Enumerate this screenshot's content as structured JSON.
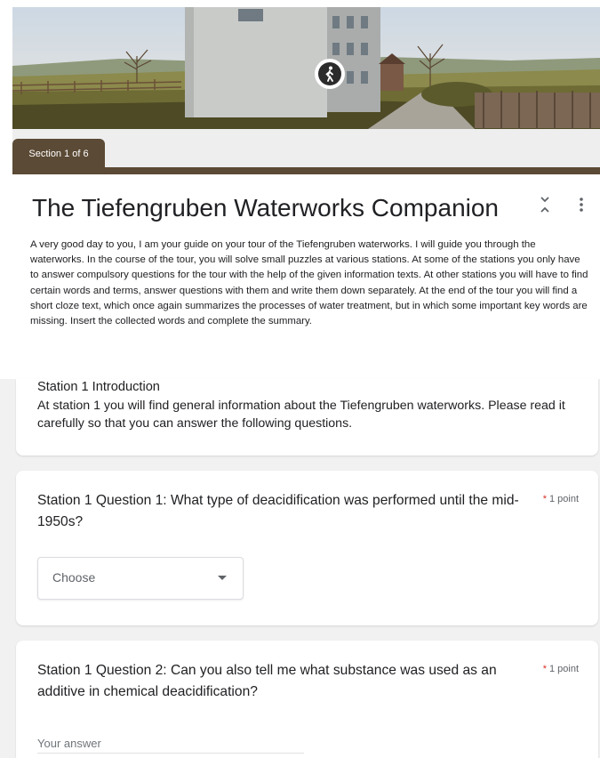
{
  "banner": {
    "icon": "walking-person-icon"
  },
  "section": {
    "label": "Section 1 of 6"
  },
  "header": {
    "title": "The Tiefengruben Waterworks Companion",
    "description": "A very good day to you, I am your guide on your tour of the Tiefengruben waterworks. I will guide you through the waterworks. In the course of the tour, you will solve small puzzles at various stations. At some of the stations you only have to answer compulsory questions for the tour with the help of the given information texts. At other stations you will have to find certain words and terms, answer questions with them and write them down separately. At the end of the tour you will find a short cloze text, which once again summarizes the processes of water treatment, but in which some important key words are missing. Insert the collected words and complete the summary.",
    "collapse_icon": "collapse-expand-icon",
    "more_icon": "more-vert-icon"
  },
  "intro": {
    "title": "Station 1 Introduction",
    "text": "At station 1 you will find general information about the Tiefengruben waterworks. Please read it carefully so that you can answer the following questions."
  },
  "questions": [
    {
      "text": "Station 1 Question 1: What type of deacidification was performed until the mid-1950s?",
      "required_mark": "*",
      "points": "1 point",
      "dropdown_value": "Choose"
    },
    {
      "text": "Station 1 Question 2: Can you also tell me what substance was used as an additive in chemical deacidification?",
      "required_mark": "*",
      "points": "1 point",
      "answer_placeholder": "Your answer"
    }
  ],
  "colors": {
    "accent": "#5b4a35",
    "required": "#d93025",
    "background": "#f1f1f1"
  }
}
